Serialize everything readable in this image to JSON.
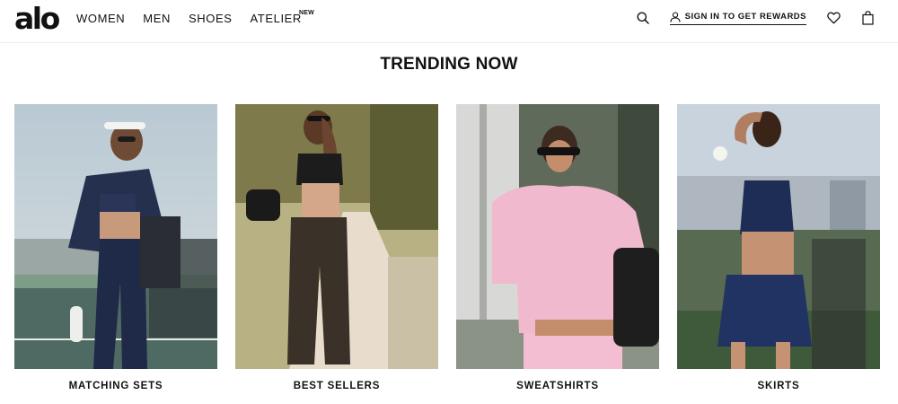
{
  "brand": {
    "logo": "alo"
  },
  "nav": [
    {
      "label": "WOMEN"
    },
    {
      "label": "MEN"
    },
    {
      "label": "SHOES"
    },
    {
      "label": "ATELIER",
      "badge": "NEW"
    }
  ],
  "header": {
    "search_icon": "search-icon",
    "signin_label": "SIGN IN TO GET REWARDS",
    "wishlist_icon": "heart-icon",
    "bag_icon": "shopping-bag-icon"
  },
  "section": {
    "title": "TRENDING NOW"
  },
  "cards": [
    {
      "label": "MATCHING SETS"
    },
    {
      "label": "BEST SELLERS"
    },
    {
      "label": "SWEATSHIRTS"
    },
    {
      "label": "SKIRTS"
    }
  ]
}
